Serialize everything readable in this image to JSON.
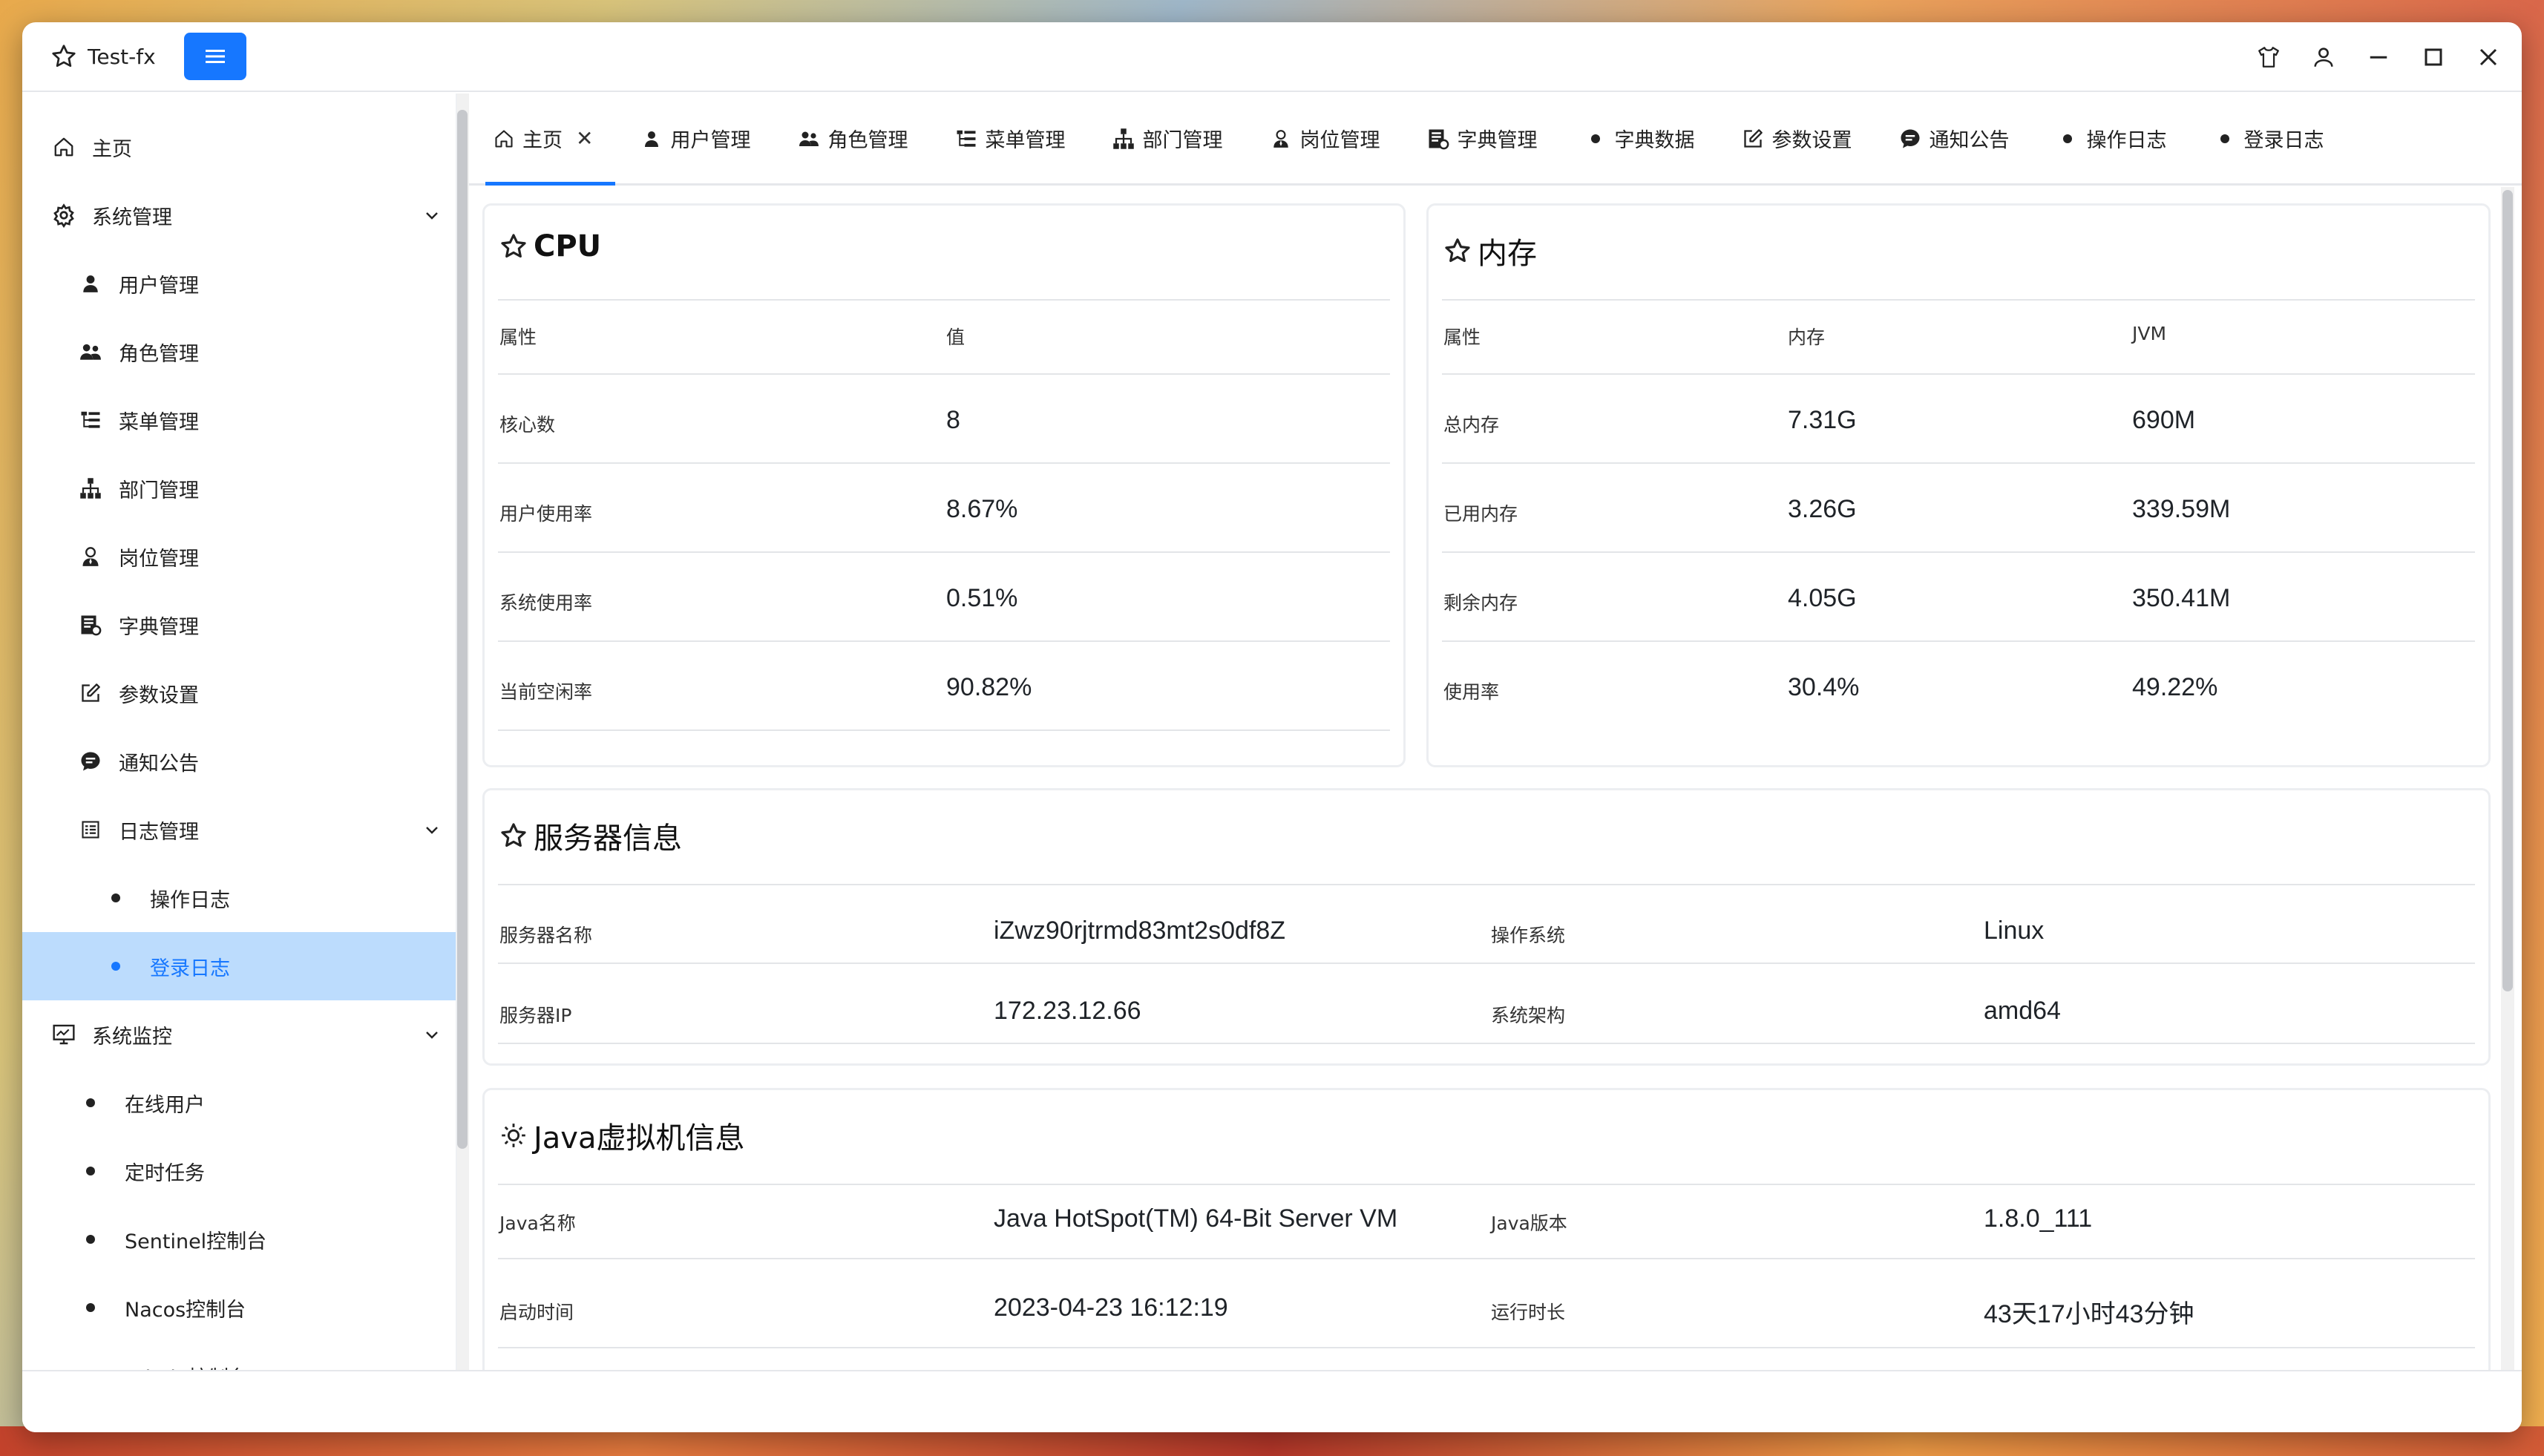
{
  "app": {
    "title": "Test-fx"
  },
  "sidebar": {
    "items": [
      {
        "label": "主页"
      },
      {
        "label": "系统管理"
      },
      {
        "label": "用户管理"
      },
      {
        "label": "角色管理"
      },
      {
        "label": "菜单管理"
      },
      {
        "label": "部门管理"
      },
      {
        "label": "岗位管理"
      },
      {
        "label": "字典管理"
      },
      {
        "label": "参数设置"
      },
      {
        "label": "通知公告"
      },
      {
        "label": "日志管理"
      },
      {
        "label": "操作日志"
      },
      {
        "label": "登录日志"
      },
      {
        "label": "系统监控"
      },
      {
        "label": "在线用户"
      },
      {
        "label": "定时任务"
      },
      {
        "label": "Sentinel控制台"
      },
      {
        "label": "Nacos控制台"
      },
      {
        "label": "Admin控制台"
      }
    ]
  },
  "tabs": [
    {
      "label": "主页"
    },
    {
      "label": "用户管理"
    },
    {
      "label": "角色管理"
    },
    {
      "label": "菜单管理"
    },
    {
      "label": "部门管理"
    },
    {
      "label": "岗位管理"
    },
    {
      "label": "字典管理"
    },
    {
      "label": "字典数据"
    },
    {
      "label": "参数设置"
    },
    {
      "label": "通知公告"
    },
    {
      "label": "操作日志"
    },
    {
      "label": "登录日志"
    }
  ],
  "cpu": {
    "title": "CPU",
    "headers": [
      "属性",
      "值"
    ],
    "rows": [
      {
        "name": "核心数",
        "value": "8"
      },
      {
        "name": "用户使用率",
        "value": "8.67%"
      },
      {
        "name": "系统使用率",
        "value": "0.51%"
      },
      {
        "name": "当前空闲率",
        "value": "90.82%"
      }
    ]
  },
  "memory": {
    "title": "内存",
    "headers": [
      "属性",
      "内存",
      "JVM"
    ],
    "rows": [
      {
        "name": "总内存",
        "mem": "7.31G",
        "jvm": "690M"
      },
      {
        "name": "已用内存",
        "mem": "3.26G",
        "jvm": "339.59M"
      },
      {
        "name": "剩余内存",
        "mem": "4.05G",
        "jvm": "350.41M"
      },
      {
        "name": "使用率",
        "mem": "30.4%",
        "jvm": "49.22%"
      }
    ]
  },
  "server": {
    "title": "服务器信息",
    "rows": [
      {
        "k1": "服务器名称",
        "v1": "iZwz90rjtrmd83mt2s0df8Z",
        "k2": "操作系统",
        "v2": "Linux"
      },
      {
        "k1": "服务器IP",
        "v1": "172.23.12.66",
        "k2": "系统架构",
        "v2": "amd64"
      }
    ]
  },
  "jvm": {
    "title": "Java虚拟机信息",
    "rows": [
      {
        "k1": "Java名称",
        "v1": "Java HotSpot(TM) 64-Bit Server VM",
        "k2": "Java版本",
        "v2": "1.8.0_111"
      },
      {
        "k1": "启动时间",
        "v1": "2023-04-23 16:12:19",
        "k2": "运行时长",
        "v2": "43天17小时43分钟"
      }
    ]
  },
  "icons": {
    "brand": "#1677ff",
    "active_bg": "#bcdcfd"
  }
}
